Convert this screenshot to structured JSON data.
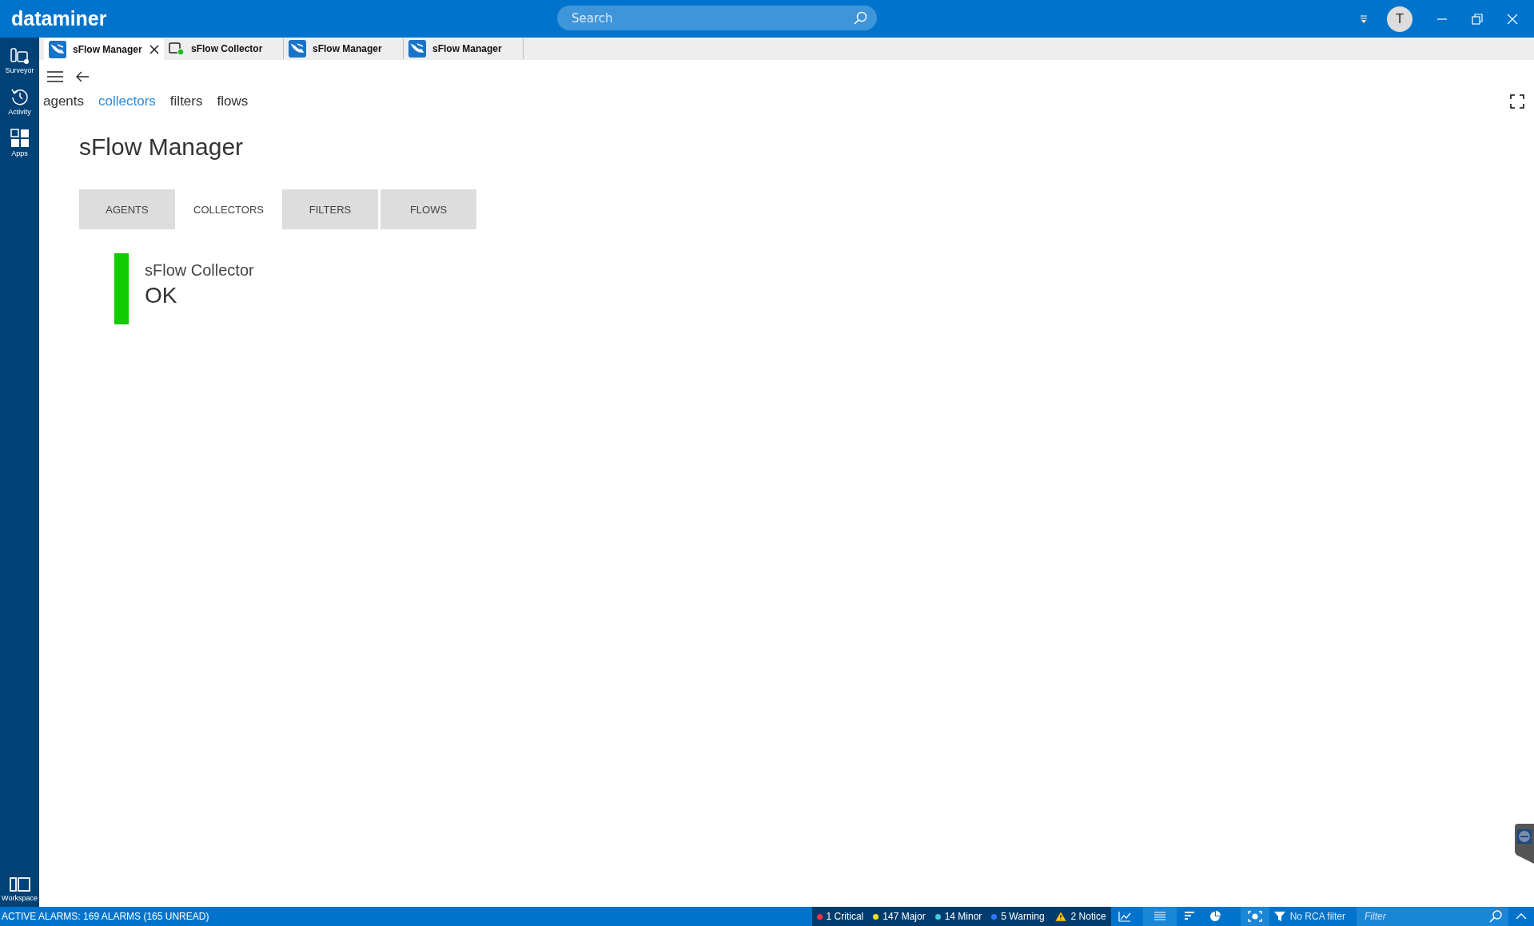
{
  "app": {
    "logo": "dataminer"
  },
  "search": {
    "placeholder": "Search"
  },
  "user": {
    "initial": "T"
  },
  "sidebar": {
    "items": [
      {
        "label": "Surveyor",
        "kind": "surveyor"
      },
      {
        "label": "Activity",
        "kind": "activity"
      },
      {
        "label": "Apps",
        "kind": "apps"
      }
    ],
    "bottom": {
      "label": "Workspace",
      "kind": "workspace"
    }
  },
  "tabs": [
    {
      "label": "sFlow Manager",
      "kind": "manager",
      "selected": true,
      "closable": true
    },
    {
      "label": "sFlow Collector",
      "kind": "element",
      "selected": false,
      "closable": false
    },
    {
      "label": "sFlow Manager",
      "kind": "manager",
      "selected": false,
      "closable": false
    },
    {
      "label": "sFlow Manager",
      "kind": "manager",
      "selected": false,
      "closable": false
    }
  ],
  "nav_links": [
    {
      "label": "agents",
      "selected": false
    },
    {
      "label": "collectors",
      "selected": true
    },
    {
      "label": "filters",
      "selected": false
    },
    {
      "label": "flows",
      "selected": false
    }
  ],
  "page": {
    "title": "sFlow Manager",
    "tabs": [
      {
        "label": "AGENTS",
        "selected": false
      },
      {
        "label": "COLLECTORS",
        "selected": true
      },
      {
        "label": "FILTERS",
        "selected": false
      },
      {
        "label": "FLOWS",
        "selected": false
      }
    ],
    "status_cards": [
      {
        "name": "sFlow Collector",
        "status": "OK",
        "color": "#11cc00"
      }
    ]
  },
  "status_bar": {
    "alarms_text": "ACTIVE ALARMS: 169 ALARMS (165 UNREAD)",
    "severities": [
      {
        "label": "1 Critical",
        "kind": "dot",
        "color": "#ff3344"
      },
      {
        "label": "147 Major",
        "kind": "dot",
        "color": "#ffdd22"
      },
      {
        "label": "14 Minor",
        "kind": "dot",
        "color": "#44ccdd"
      },
      {
        "label": "5 Warning",
        "kind": "dot",
        "color": "#3377ff"
      },
      {
        "label": "2 Notice",
        "kind": "triangle",
        "color": "#ffcc00"
      }
    ],
    "rca_filter": "No RCA filter",
    "filter": {
      "placeholder": "Filter"
    }
  }
}
